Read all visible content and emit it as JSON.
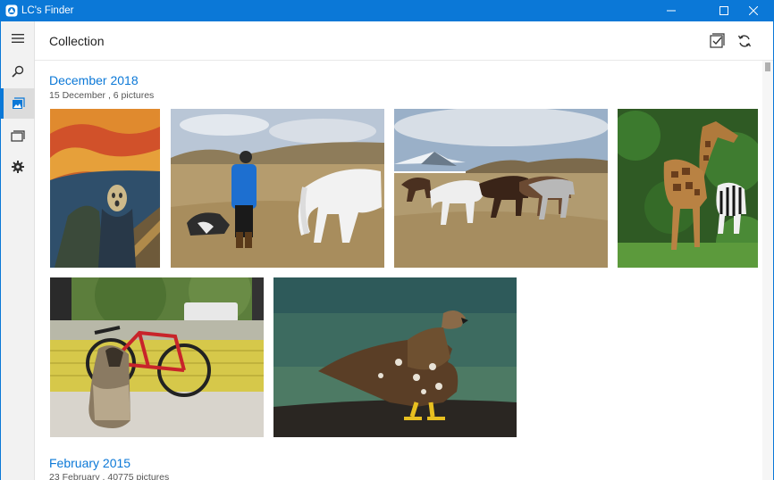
{
  "window": {
    "title": "LC's Finder",
    "controls": [
      "minimize",
      "maximize",
      "close"
    ],
    "accent": "#0b78d7"
  },
  "sidebar": {
    "items": [
      {
        "icon": "hamburger-menu-icon",
        "active": false
      },
      {
        "icon": "search-icon",
        "active": false
      },
      {
        "icon": "photo-collection-icon",
        "active": true
      },
      {
        "icon": "folders-icon",
        "active": false
      },
      {
        "icon": "gear-icon",
        "active": false
      }
    ]
  },
  "header": {
    "title": "Collection",
    "actions": [
      "select-icon",
      "refresh-icon"
    ]
  },
  "groups": [
    {
      "title": "December 2018",
      "subtitle": "15 December , 6 pictures",
      "photos": [
        "the-scream-painting",
        "person-dog-white-horse",
        "horses-herd-mountains",
        "giraffe-zebra",
        "dog-bicycle-porch",
        "eagle-on-shore"
      ]
    },
    {
      "title": "February 2015",
      "subtitle": "23 February , 40775 pictures"
    }
  ]
}
